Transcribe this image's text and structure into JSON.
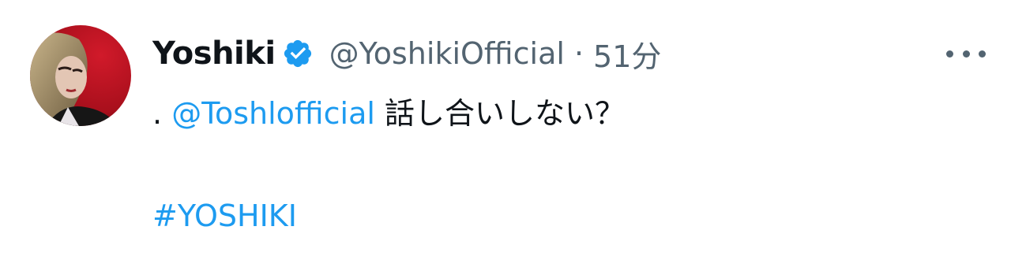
{
  "tweet": {
    "author": {
      "display_name": "Yoshiki",
      "handle": "@YoshikiOfficial",
      "verified_icon": "verified-badge-icon"
    },
    "separator": "·",
    "timestamp": "51分",
    "more_icon": "more-options-icon",
    "text": {
      "prefix": ".",
      "mention": "@Toshlofficial",
      "message": "話し合いしない？",
      "hashtag": "#YOSHIKI"
    }
  },
  "colors": {
    "link": "#1d9bf0",
    "text": "#0f1419",
    "secondary": "#536471",
    "verified": "#1d9bf0"
  }
}
